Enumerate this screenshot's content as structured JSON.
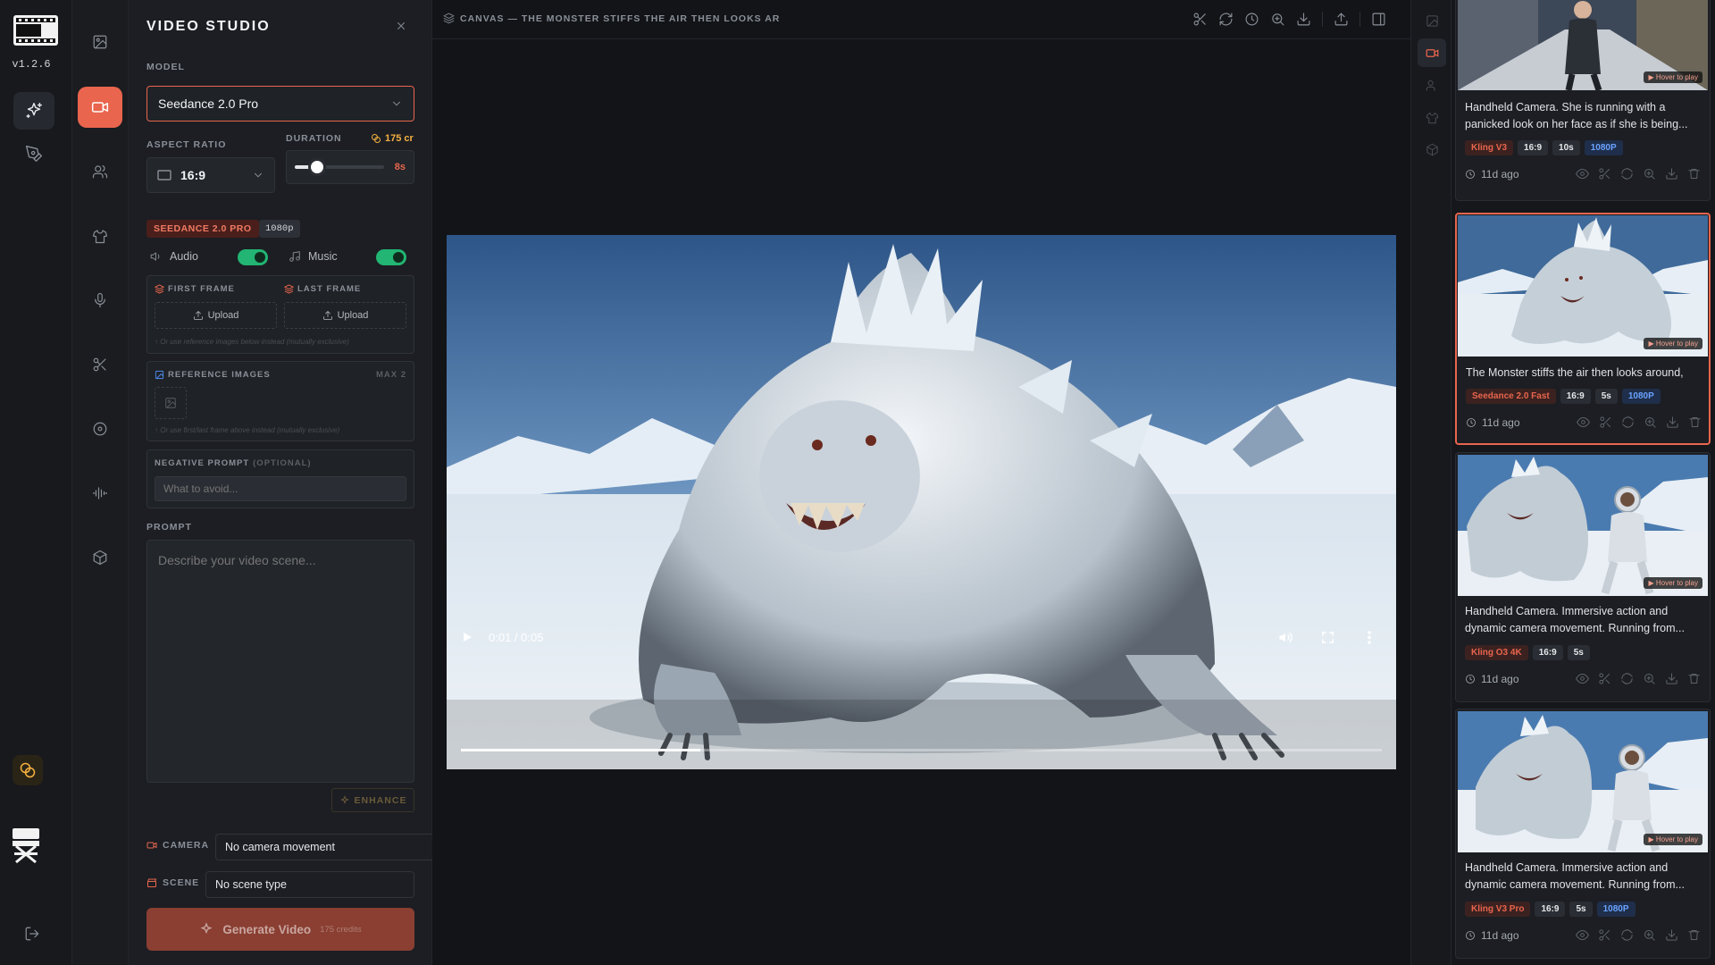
{
  "app": {
    "version": "v1.2.6"
  },
  "studio": {
    "title": "VIDEO STUDIO",
    "model_label": "MODEL",
    "model_value": "Seedance 2.0 Pro",
    "aspect_label": "ASPECT RATIO",
    "aspect_value": "16:9",
    "duration_label": "DURATION",
    "credits": "175 cr",
    "duration_value": "8s",
    "duration_fraction": 0.25,
    "badge_model": "SEEDANCE 2.0 PRO",
    "badge_res": "1080p",
    "audio_label": "Audio",
    "music_label": "Music",
    "audio_on": true,
    "music_on": true,
    "first_frame_label": "FIRST FRAME",
    "last_frame_label": "LAST FRAME",
    "upload_label": "Upload",
    "frames_hint": "↑ Or use reference images below instead (mutually exclusive)",
    "ref_label": "REFERENCE IMAGES",
    "ref_max": "MAX 2",
    "ref_hint": "↑ Or use first/last frame above instead (mutually exclusive)",
    "neg_label": "NEGATIVE PROMPT",
    "neg_optional": "(OPTIONAL)",
    "neg_placeholder": "What to avoid...",
    "prompt_label": "PROMPT",
    "prompt_placeholder": "Describe your video scene...",
    "enhance_label": "ENHANCE",
    "camera_label": "CAMERA",
    "camera_value": "No camera movement",
    "scene_label": "SCENE",
    "scene_value": "No scene type",
    "generate_label": "Generate Video",
    "generate_credits": "175 credits"
  },
  "canvas": {
    "title": "CANVAS — THE MONSTER STIFFS THE AIR THEN LOOKS AR",
    "time": "0:01 / 0:05",
    "progress_fraction": 0.26
  },
  "gallery": [
    {
      "desc": "Handheld Camera. She is running with a panicked look on her face as if she is being...",
      "model": "Kling V3",
      "ratio": "16:9",
      "duration": "10s",
      "res": "1080P",
      "age": "11d ago",
      "hover": "▶ Hover to play",
      "selected": false
    },
    {
      "desc": "The Monster stiffs the air then looks around,",
      "model": "Seedance 2.0 Fast",
      "ratio": "16:9",
      "duration": "5s",
      "res": "1080P",
      "age": "11d ago",
      "hover": "▶ Hover to play",
      "selected": true
    },
    {
      "desc": "Handheld Camera. Immersive action and dynamic camera movement. Running from...",
      "model": "Kling O3 4K",
      "ratio": "16:9",
      "duration": "5s",
      "res": "",
      "age": "11d ago",
      "hover": "▶ Hover to play",
      "selected": false
    },
    {
      "desc": "Handheld Camera. Immersive action and dynamic camera movement. Running from...",
      "model": "Kling V3 Pro",
      "ratio": "16:9",
      "duration": "5s",
      "res": "1080P",
      "age": "11d ago",
      "hover": "▶ Hover to play",
      "selected": false
    }
  ],
  "colors": {
    "accent": "#e9654d",
    "toggle": "#22b573",
    "credits": "#f5b041",
    "res_tag": "#6aa3ff"
  }
}
